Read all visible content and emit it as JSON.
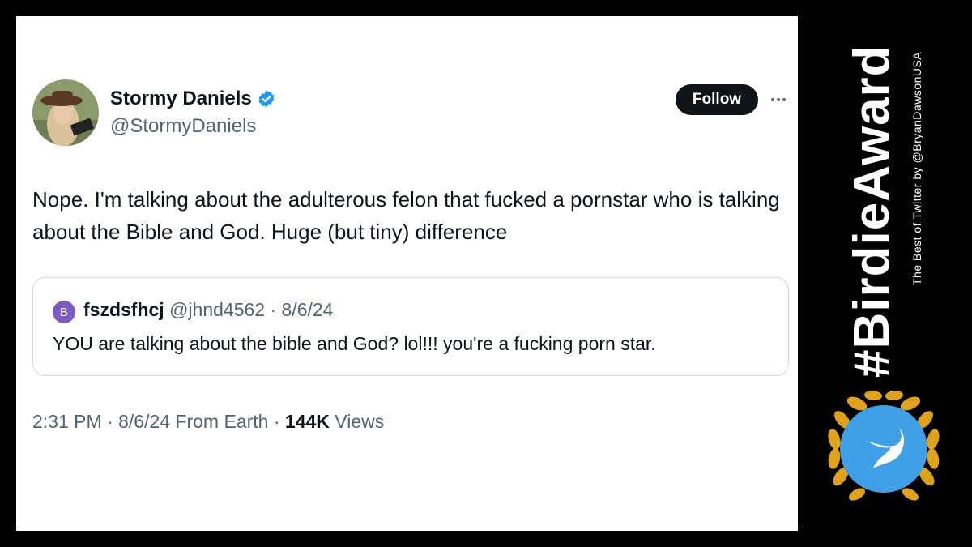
{
  "tweet": {
    "author_name": "Stormy Daniels",
    "author_handle": "@StormyDaniels",
    "follow_label": "Follow",
    "text": "Nope. I'm talking about the adulterous felon that fucked a pornstar who is talking about the Bible and God. Huge (but tiny) difference",
    "icons": [
      "verified-badge-icon",
      "more-options-icon"
    ]
  },
  "quote": {
    "avatar_letter": "B",
    "name": "fszdsfhcj",
    "handle_date": "@jhnd4562 · 8/6/24",
    "text": "YOU are talking about the bible and God?  lol!!! you're a fucking porn star."
  },
  "meta": {
    "time_date": "2:31 PM · 8/6/24 From Earth · ",
    "views_count": "144K",
    "views_label": " Views"
  },
  "branding": {
    "hashtag": "#BirdieAward",
    "credit": "The Best of Twitter by @BryanDawsonUSA",
    "colors": {
      "laurel": "#e0a21b",
      "bird_circle": "#3fa0e8",
      "verified": "#1d9bf0"
    }
  }
}
